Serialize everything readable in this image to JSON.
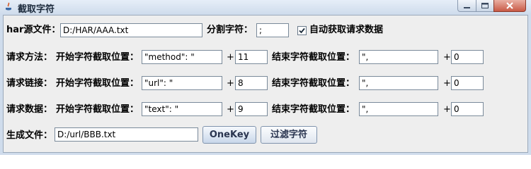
{
  "window": {
    "title": "截取字符"
  },
  "row1": {
    "har_label": "har源文件：",
    "har_value": "D:/HAR/AAA.txt",
    "split_label": "分割字符：",
    "split_value": ";",
    "auto_label": "自动获取请求数据",
    "auto_checked": true
  },
  "rows": [
    {
      "label": "请求方法：",
      "start_label": "开始字符截取位置：",
      "start_value": "\"method\": \"",
      "plus": "+",
      "start_offset": "11",
      "end_label": "结束字符截取位置：",
      "end_value": "\",",
      "end_offset": "0"
    },
    {
      "label": "请求链接：",
      "start_label": "开始字符截取位置：",
      "start_value": "\"url\": \"",
      "plus": "+",
      "start_offset": "8",
      "end_label": "结束字符截取位置：",
      "end_value": "\",",
      "end_offset": "0"
    },
    {
      "label": "请求数据：",
      "start_label": "开始字符截取位置：",
      "start_value": "\"text\": \"",
      "plus": "+",
      "start_offset": "9",
      "end_label": "结束字符截取位置：",
      "end_value": "\",",
      "end_offset": "0"
    }
  ],
  "output": {
    "label": "生成文件：",
    "value": "D:/url/BBB.txt"
  },
  "buttons": {
    "onekey": "OneKey",
    "filter": "过滤字符"
  },
  "colors": {
    "window_frame": "#cfdcec",
    "panel_bg": "#eeeeee",
    "close_button": "#c85a45"
  }
}
